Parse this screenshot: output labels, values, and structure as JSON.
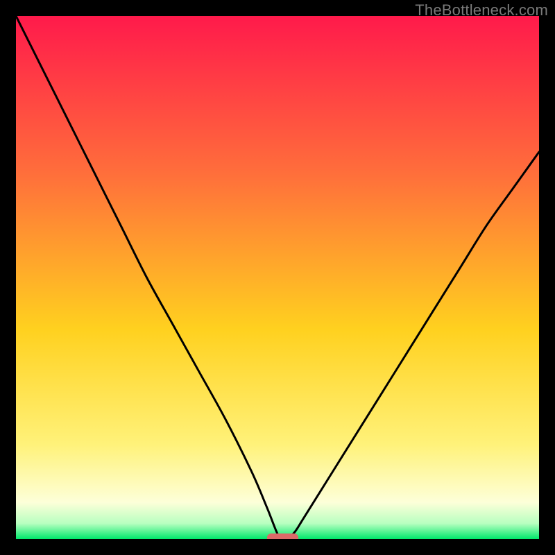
{
  "watermark": "TheBottleneck.com",
  "colors": {
    "frame_bg": "#000000",
    "gradient_top": "#ff1a4b",
    "gradient_mid_upper": "#ff6e3b",
    "gradient_mid": "#ffd11f",
    "gradient_mid_lower": "#fff27a",
    "gradient_near_bottom": "#fdffd9",
    "gradient_bottom": "#00e86b",
    "curve": "#000000",
    "marker": "#db6a68"
  },
  "chart_data": {
    "type": "line",
    "title": "",
    "xlabel": "",
    "ylabel": "",
    "xlim": [
      0,
      100
    ],
    "ylim": [
      0,
      100
    ],
    "annotations": [
      {
        "text": "TheBottleneck.com",
        "role": "watermark",
        "position": "top-right"
      }
    ],
    "series": [
      {
        "name": "bottleneck-curve",
        "note": "V-shaped curve; left branch steep convex decline from top-left, right branch near-linear rise toward right edge; minimum touches y≈0 near x≈51",
        "x": [
          0,
          5,
          10,
          15,
          20,
          25,
          30,
          35,
          40,
          45,
          48,
          50,
          51,
          53,
          55,
          60,
          65,
          70,
          75,
          80,
          85,
          90,
          95,
          100
        ],
        "y": [
          100,
          90,
          80,
          70,
          60,
          50,
          41,
          32,
          23,
          13,
          6,
          1,
          0,
          1,
          4,
          12,
          20,
          28,
          36,
          44,
          52,
          60,
          67,
          74
        ]
      }
    ],
    "marker": {
      "shape": "rounded-bar",
      "x_center": 51,
      "y": 0,
      "width_x_units": 6,
      "color": "#db6a68"
    },
    "background_gradient_stops": [
      {
        "pos": 0.0,
        "color": "#ff1a4b"
      },
      {
        "pos": 0.3,
        "color": "#ff6e3b"
      },
      {
        "pos": 0.6,
        "color": "#ffd11f"
      },
      {
        "pos": 0.82,
        "color": "#fff27a"
      },
      {
        "pos": 0.93,
        "color": "#fdffd9"
      },
      {
        "pos": 0.97,
        "color": "#b8ffc0"
      },
      {
        "pos": 1.0,
        "color": "#00e86b"
      }
    ]
  }
}
